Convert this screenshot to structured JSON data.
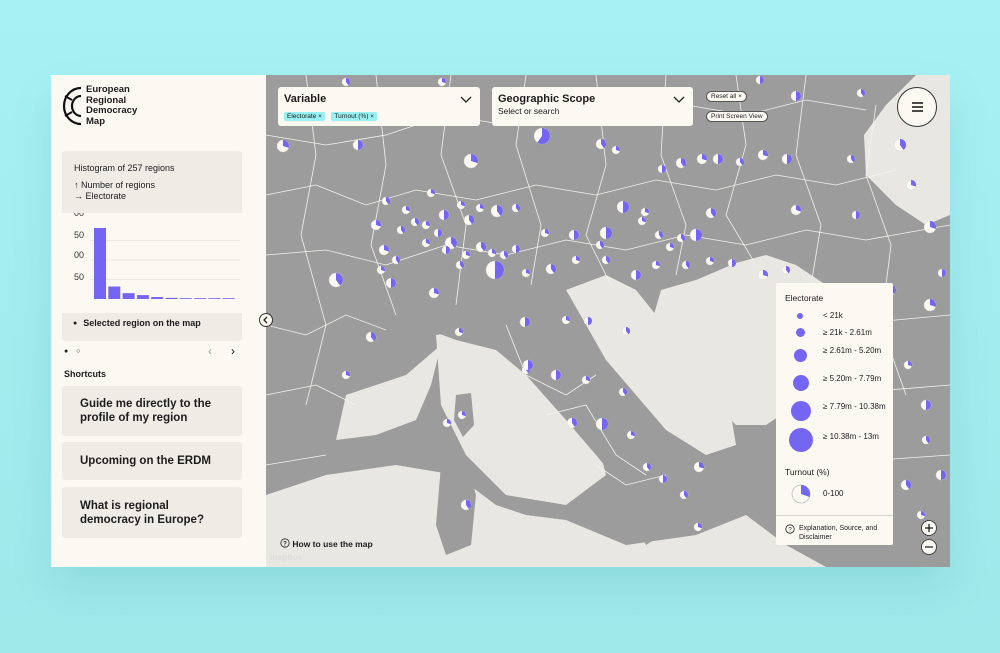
{
  "logo": {
    "text": "European\nRegional\nDemocracy\nMap"
  },
  "histogram": {
    "title": "Histogram of 257 regions",
    "legend_y": "Number of regions",
    "legend_x": "Electorate",
    "y_ticks": [
      "00",
      "50",
      "00",
      "50"
    ],
    "bar_values": [
      182,
      32,
      15,
      10,
      5,
      3,
      2,
      2,
      1,
      1
    ],
    "bar_color": "#7565f3",
    "selected_note": "Selected region on the map"
  },
  "pager": {
    "dots": "● ○",
    "prev": "‹",
    "next": "›"
  },
  "shortcuts": {
    "title": "Shortcuts",
    "items": [
      "Guide me directly to the profile of my region",
      "Upcoming on the ERDM",
      "What is regional democracy in Europe?"
    ]
  },
  "variable_dd": {
    "title": "Variable",
    "chips": [
      "Electorate",
      "Turnout (%)"
    ],
    "chip_remove": "×"
  },
  "scope_dd": {
    "title": "Geographic Scope",
    "placeholder": "Select or search"
  },
  "reset_label": "Reset all",
  "print_label": "Print Screen View",
  "legend": {
    "electorate_title": "Electorate",
    "sizes": [
      "< 21k",
      "≥ 21k - 2.61m",
      "≥ 2.61m - 5.20m",
      "≥ 5.20m - 7.79m",
      "≥ 7.79m - 10.38m",
      "≥ 10.38m - 13m"
    ],
    "turnout_title": "Turnout (%)",
    "turnout_range": "0-100",
    "explanation": "Explanation, Source, and Disclaimer"
  },
  "how_to": "How to use the map",
  "attribution": "mapbox",
  "colors": {
    "accent": "#7565f3",
    "chip": "#98f0f2",
    "land": "#9c9c9c",
    "outside": "#e9e7e2",
    "panel": "#fcf9f3"
  },
  "icons": [
    "menu-icon",
    "chevron-down-icon",
    "chevron-left-icon",
    "help-icon",
    "close-icon",
    "plus-icon",
    "minus-icon"
  ]
}
